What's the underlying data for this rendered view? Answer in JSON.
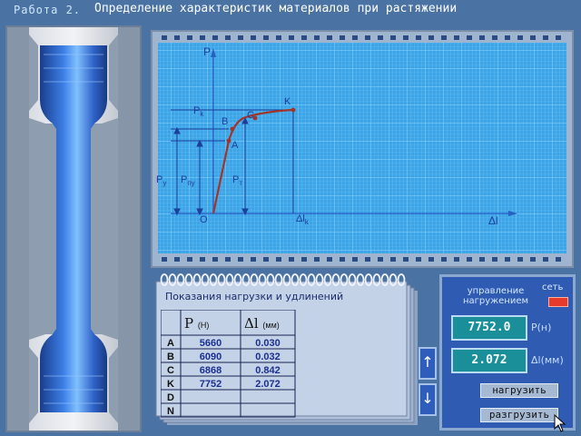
{
  "title": {
    "work_label": "Работа 2.",
    "text": "Определение характеристик материалов при растяжении"
  },
  "graph": {
    "axis_p": "P",
    "axis_dl": "Δl",
    "labels": {
      "pk": "P",
      "pk_sub": "k",
      "py": "P",
      "py_sub": "y",
      "ppu": "P",
      "ppu_sub": "пу",
      "pt": "P",
      "pt_sub": "т",
      "dlk": "Δl",
      "dlk_sub": "k",
      "origin": "O",
      "a": "A",
      "b": "B",
      "c": "C",
      "k": "K"
    }
  },
  "notebook": {
    "title": "Показания нагрузки и удлинений",
    "col_p": "P",
    "col_p_unit": "(Н)",
    "col_dl": "Δl",
    "col_dl_unit": "(мм)",
    "rows": [
      {
        "label": "A",
        "p": "5660",
        "dl": "0.030"
      },
      {
        "label": "B",
        "p": "6090",
        "dl": "0.032"
      },
      {
        "label": "C",
        "p": "6868",
        "dl": "0.842"
      },
      {
        "label": "K",
        "p": "7752",
        "dl": "2.072"
      },
      {
        "label": "D",
        "p": "",
        "dl": ""
      },
      {
        "label": "N",
        "p": "",
        "dl": ""
      }
    ]
  },
  "scroll": {
    "up": "↑",
    "down": "↓"
  },
  "control": {
    "title_line1": "управление",
    "title_line2": "нагружением",
    "net_label": "сеть",
    "load_value": "7752.0",
    "load_unit": "P(н)",
    "elong_value": "2.072",
    "elong_unit": "Δl(мм)",
    "load_button": "нагрузить",
    "unload_button": "разгрузить"
  },
  "colors": {
    "background": "#4a73a4",
    "grid_bg": "#3ea4e8",
    "grid_line": "#6fc3f3",
    "curve": "#a0352a",
    "readout": "#1a8f9a",
    "led": "#e53a2c"
  }
}
